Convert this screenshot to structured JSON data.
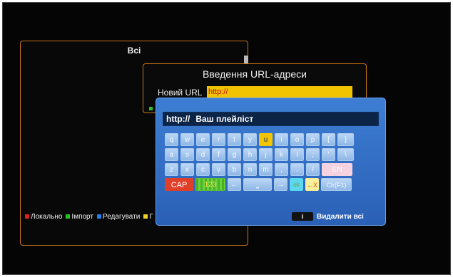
{
  "background_panel": {
    "title": "Всі",
    "legend": [
      {
        "label": "Локально",
        "color": "#e02020"
      },
      {
        "label": "Імпорт",
        "color": "#20c020"
      },
      {
        "label": "Редагувати",
        "color": "#2080f0"
      },
      {
        "label": "Г",
        "color": "#f0d020"
      }
    ]
  },
  "url_dialog": {
    "title": "Введення URL-адреси",
    "label": "Новий URL",
    "value": "http://"
  },
  "keyboard": {
    "prefix": "http://",
    "text": "Ваш плейліст",
    "rows": [
      [
        "q",
        "w",
        "e",
        "r",
        "t",
        "y",
        "u",
        "i",
        "o",
        "p",
        "[",
        "]"
      ],
      [
        "a",
        "s",
        "d",
        "f",
        "g",
        "h",
        "j",
        "k",
        "l",
        ";",
        "'",
        "\\"
      ],
      [
        "z",
        "x",
        "c",
        "v",
        "b",
        "n",
        "m",
        ",",
        ".",
        "/",
        "EN"
      ],
      [
        "CAP",
        "123",
        "←",
        "⎵",
        "→",
        "ok",
        "←X",
        "Clr(F1)"
      ]
    ],
    "selected_key": "u",
    "delete_all_label": "Видалити всі",
    "info_icon": "i"
  }
}
